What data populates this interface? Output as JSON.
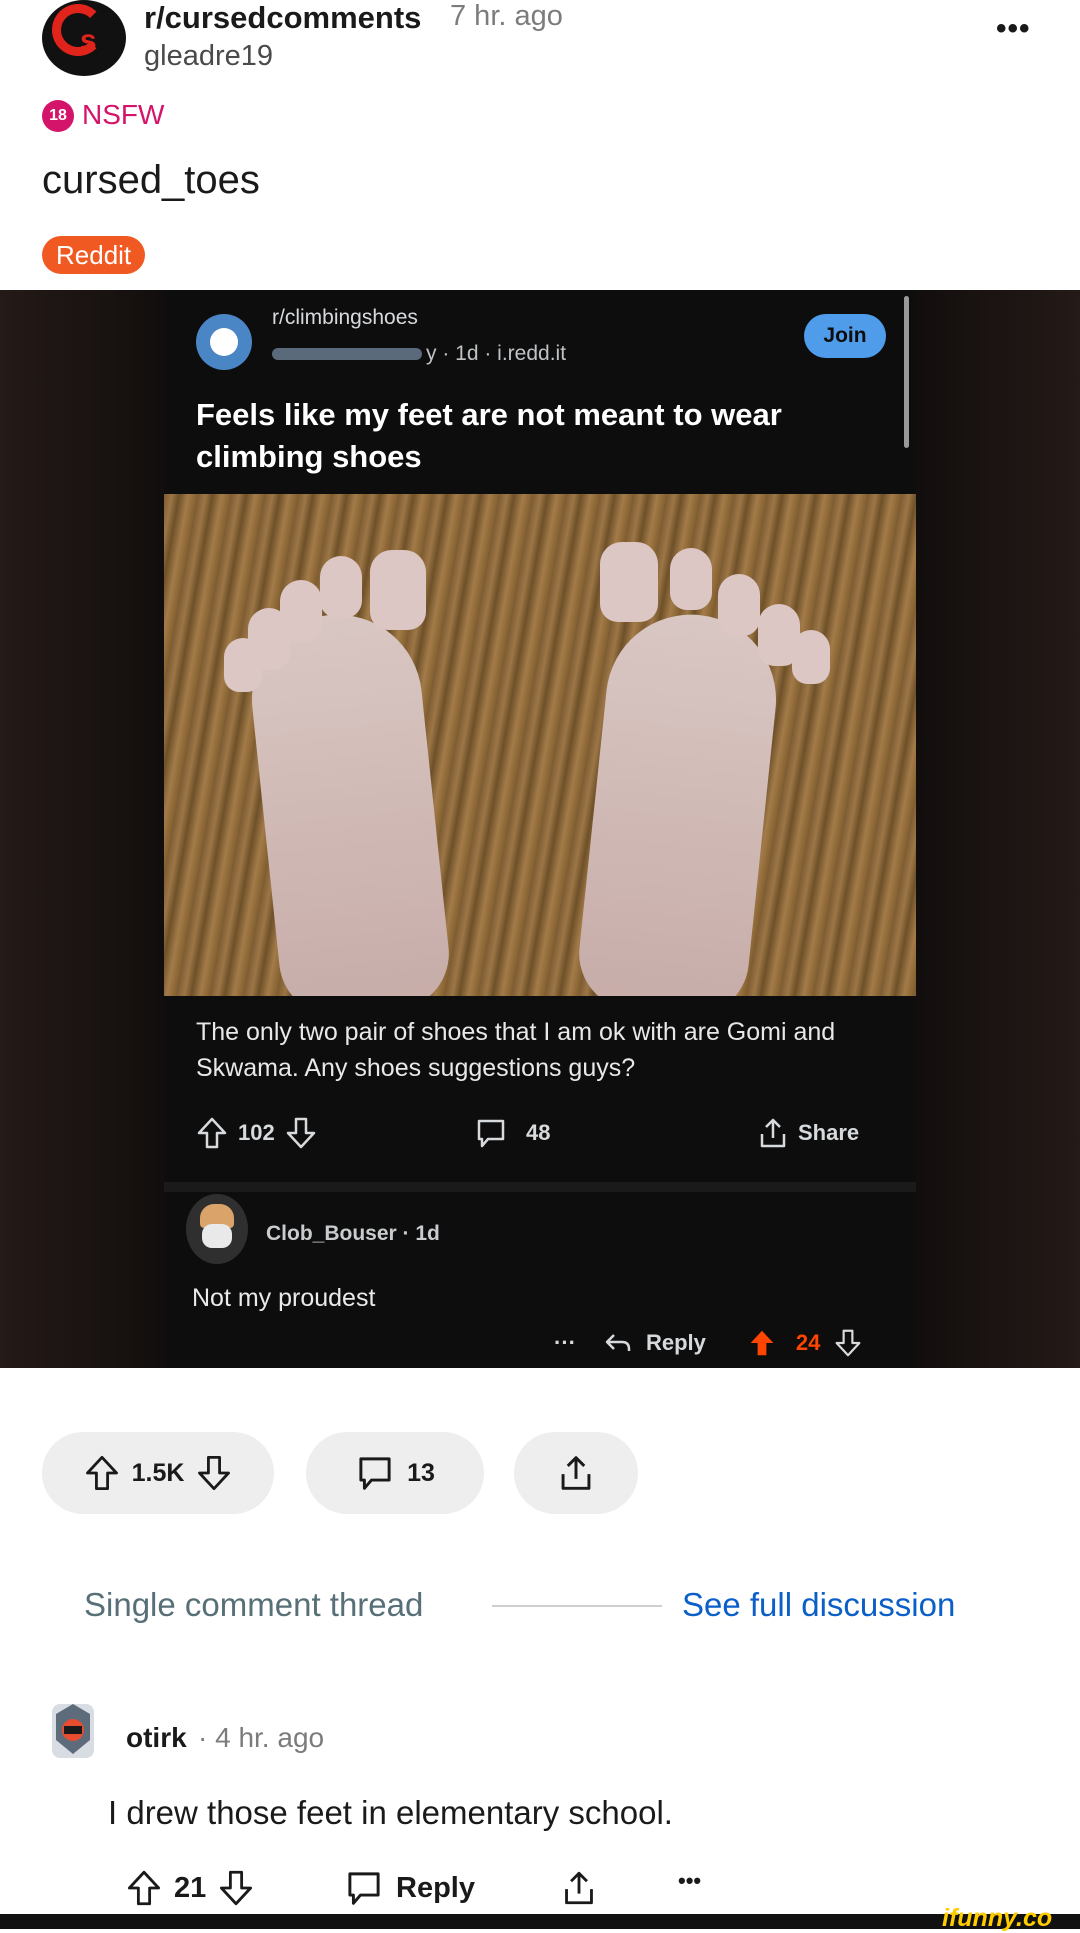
{
  "header": {
    "subreddit": "r/cursedcomments",
    "age": "7 hr. ago",
    "user": "gleadre19",
    "more": "•••",
    "nsfw_badge": "18",
    "nsfw_label": "NSFW",
    "title": "cursed_toes",
    "flair": "Reddit"
  },
  "embed": {
    "subreddit": "r/climbingshoes",
    "meta": "y · 1d · i.redd.it",
    "join": "Join",
    "title": "Feels like my feet are not meant to wear climbing shoes",
    "body": "The only two pair of shoes that I am ok with are Gomi and Skwama. Any shoes suggestions guys?",
    "upvotes": "102",
    "comments": "48",
    "share": "Share",
    "comment": {
      "user": "Clob_Bouser · 1d",
      "body": "Not my proudest",
      "more": "···",
      "reply": "Reply",
      "votes": "24"
    }
  },
  "actions": {
    "votes": "1.5K",
    "comments": "13"
  },
  "thread": {
    "label": "Single comment thread",
    "see_full": "See full discussion"
  },
  "comment": {
    "user": "otirk",
    "age": "· 4 hr. ago",
    "body": "I drew those feet in elementary school.",
    "votes": "21",
    "reply": "Reply",
    "more": "•••"
  },
  "watermark": "ifunny.co",
  "colors": {
    "nsfw": "#d4146a",
    "flair": "#f05a22",
    "link": "#0a5fc8",
    "join": "#4f9ceb",
    "upvote_active": "#ff4500"
  }
}
